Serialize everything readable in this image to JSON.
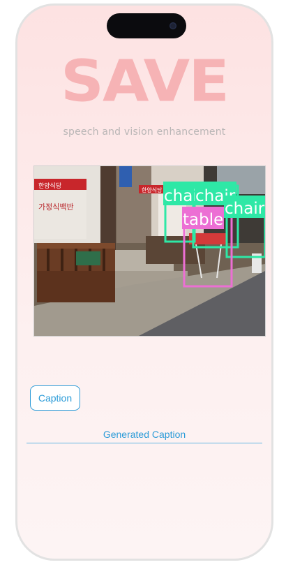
{
  "app": {
    "logo_text": "SAVE",
    "tagline": "speech and vision enhancement"
  },
  "detection_image": {
    "description_icon": "street-scene-photo",
    "detections": [
      {
        "label": "chai",
        "color": "#2ee8a6"
      },
      {
        "label": "chair",
        "color": "#2ee8a6"
      },
      {
        "label": "chair",
        "color": "#2ee8a6"
      },
      {
        "label": "table",
        "color": "#ec6fd4"
      }
    ],
    "signs": [
      "한양식당",
      "가정식백반",
      "한양식당"
    ]
  },
  "controls": {
    "caption_button": "Caption",
    "generated_caption": "Generated Caption"
  },
  "colors": {
    "accent": "#2a9bd8",
    "logo": "#f6b3b5",
    "chair_box": "#2ee8a6",
    "table_box": "#ec6fd4"
  }
}
